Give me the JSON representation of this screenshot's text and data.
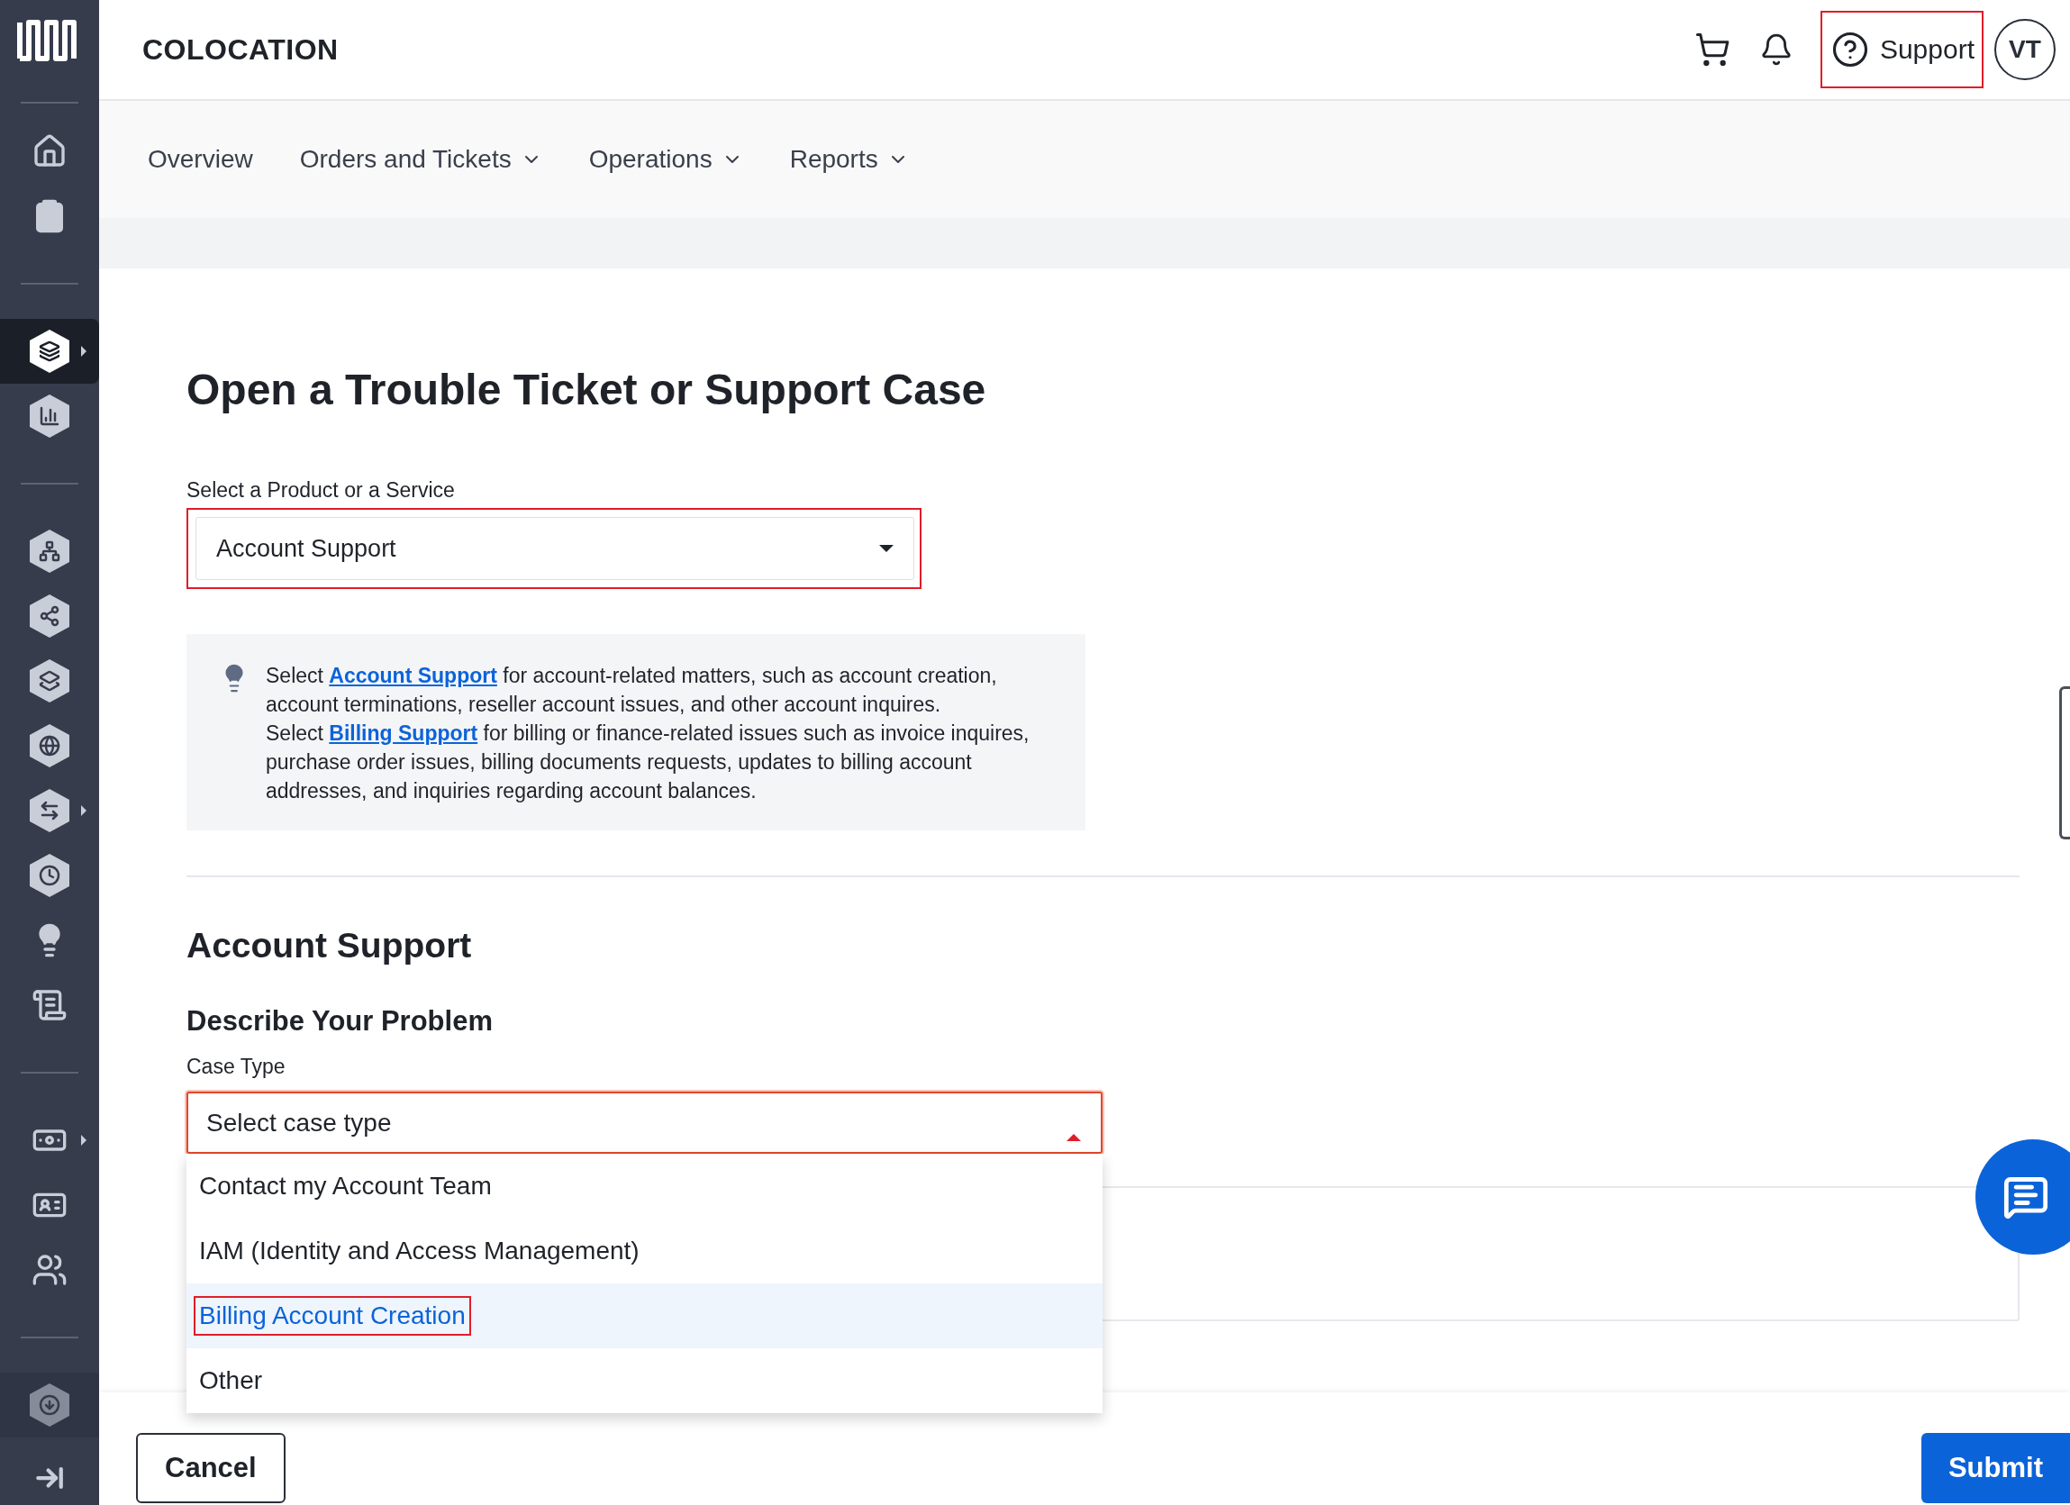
{
  "sidebar": {
    "groups": [
      {
        "items": [
          {
            "selected": false,
            "submenu": false,
            "disabled": false
          },
          {
            "selected": false,
            "submenu": false,
            "disabled": false
          }
        ]
      },
      {
        "items": [
          {
            "selected": true,
            "submenu": true,
            "disabled": false
          },
          {
            "selected": false,
            "submenu": false,
            "disabled": false
          }
        ]
      },
      {
        "items": [
          {
            "selected": false,
            "submenu": false,
            "disabled": false
          },
          {
            "selected": false,
            "submenu": false,
            "disabled": false
          },
          {
            "selected": false,
            "submenu": false,
            "disabled": false
          },
          {
            "selected": false,
            "submenu": false,
            "disabled": false
          },
          {
            "selected": false,
            "submenu": true,
            "disabled": false
          },
          {
            "selected": false,
            "submenu": false,
            "disabled": false
          },
          {
            "selected": false,
            "submenu": false,
            "disabled": false
          },
          {
            "selected": false,
            "submenu": false,
            "disabled": false
          }
        ]
      },
      {
        "items": [
          {
            "selected": false,
            "submenu": true,
            "disabled": false
          },
          {
            "selected": false,
            "submenu": false,
            "disabled": false
          },
          {
            "selected": false,
            "submenu": false,
            "disabled": false
          }
        ]
      },
      {
        "items": [
          {
            "selected": false,
            "submenu": false,
            "disabled": true
          }
        ]
      }
    ]
  },
  "header": {
    "title": "COLOCATION",
    "support": {
      "label": "Support",
      "highlighted": true
    },
    "avatar": "VT"
  },
  "nav": [
    {
      "label": "Overview",
      "dropdown": false
    },
    {
      "label": "Orders and Tickets",
      "dropdown": true
    },
    {
      "label": "Operations",
      "dropdown": true
    },
    {
      "label": "Reports",
      "dropdown": true
    }
  ],
  "page": {
    "title": "Open a Trouble Ticket or Support Case",
    "product_field": {
      "label": "Select a Product or a Service",
      "value": "Account Support",
      "highlighted": true
    },
    "info": [
      {
        "before": "Select ",
        "link": "Account Support",
        "after": " for account-related matters, such as account creation, account terminations, reseller account issues, and other account inquires."
      },
      {
        "before": "Select ",
        "link": "Billing Support",
        "after": " for billing or finance-related issues such as invoice inquires, purchase order issues, billing documents requests, updates to billing account addresses, and inquiries regarding account balances."
      }
    ],
    "section_title": "Account Support",
    "subsection_title": "Describe Your Problem",
    "case_type": {
      "label": "Case Type",
      "placeholder": "Select case type",
      "open": true,
      "options": [
        {
          "label": "Contact my Account Team",
          "selected": false,
          "highlighted": false
        },
        {
          "label": "IAM (Identity and Access Management)",
          "selected": false,
          "highlighted": false
        },
        {
          "label": "Billing Account Creation",
          "selected": true,
          "highlighted": true
        },
        {
          "label": "Other",
          "selected": false,
          "highlighted": false
        }
      ]
    }
  },
  "footer": {
    "buttons": [
      {
        "label": "Cancel",
        "kind": "secondary"
      },
      {
        "label": "Submit",
        "kind": "primary"
      }
    ]
  }
}
